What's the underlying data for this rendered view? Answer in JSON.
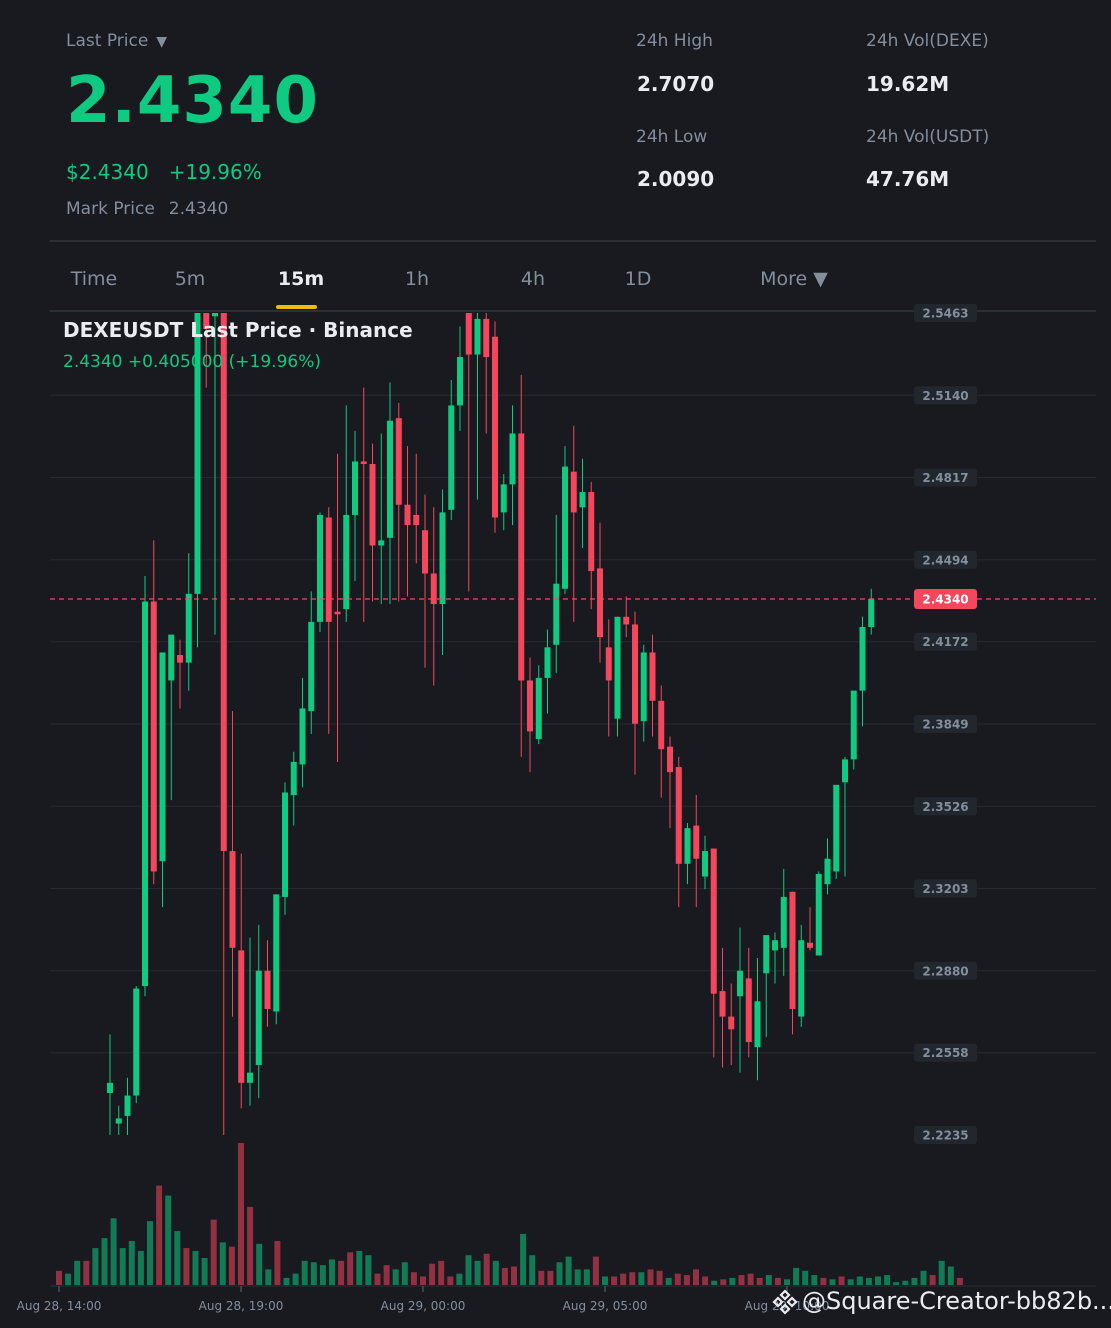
{
  "header": {
    "last_price_label": "Last Price",
    "caret": "▼",
    "last_price": "2.4340",
    "usd_price": "$2.4340",
    "change_pct": "+19.96%",
    "mark_price_label": "Mark Price",
    "mark_price": "2.4340",
    "stats": {
      "high_label": "24h High",
      "high": "2.7070",
      "low_label": "24h Low",
      "low": "2.0090",
      "vol_base_label": "24h Vol(DEXE)",
      "vol_base": "19.62M",
      "vol_quote_label": "24h Vol(USDT)",
      "vol_quote": "47.76M"
    }
  },
  "tabs": [
    {
      "label": "Time",
      "active": false
    },
    {
      "label": "5m",
      "active": false
    },
    {
      "label": "15m",
      "active": true
    },
    {
      "label": "1h",
      "active": false
    },
    {
      "label": "4h",
      "active": false
    },
    {
      "label": "1D",
      "active": false
    },
    {
      "label": "More ▼",
      "active": false
    }
  ],
  "legend": {
    "title": "DEXEUSDT Last Price · Binance",
    "values": "2.4340  +0.405000 (+19.96%)"
  },
  "watermark": "@Square-Creator-bb82b...",
  "colors": {
    "up": "#0ecb81",
    "down": "#f6465d",
    "accent": "#f0b90b",
    "background": "#181a20"
  },
  "chart_data": {
    "type": "candlestick",
    "symbol": "DEXEUSDT",
    "interval": "15m",
    "current_price": 2.434,
    "y_ticks": [
      "2.5463",
      "2.5140",
      "2.4817",
      "2.4494",
      "2.4172",
      "2.3849",
      "2.3526",
      "2.3203",
      "2.2880",
      "2.2558",
      "2.2235"
    ],
    "y_range": [
      2.2235,
      2.5463
    ],
    "x_ticks": [
      "Aug 28, 14:00",
      "Aug 28, 19:00",
      "Aug 29, 00:00",
      "Aug 29, 05:00",
      "Aug 29, 10:00"
    ],
    "candles": [
      {
        "o": 2.24,
        "h": 2.263,
        "l": 2.22,
        "c": 2.244
      },
      {
        "o": 2.228,
        "h": 2.235,
        "l": 2.22,
        "c": 2.23
      },
      {
        "o": 2.231,
        "h": 2.246,
        "l": 2.22,
        "c": 2.239
      },
      {
        "o": 2.239,
        "h": 2.282,
        "l": 2.236,
        "c": 2.281
      },
      {
        "o": 2.282,
        "h": 2.443,
        "l": 2.278,
        "c": 2.433
      },
      {
        "o": 2.433,
        "h": 2.457,
        "l": 2.322,
        "c": 2.327
      },
      {
        "o": 2.331,
        "h": 2.406,
        "l": 2.313,
        "c": 2.413
      },
      {
        "o": 2.402,
        "h": 2.419,
        "l": 2.355,
        "c": 2.42
      },
      {
        "o": 2.412,
        "h": 2.418,
        "l": 2.391,
        "c": 2.409
      },
      {
        "o": 2.409,
        "h": 2.452,
        "l": 2.398,
        "c": 2.436
      },
      {
        "o": 2.436,
        "h": 2.57,
        "l": 2.415,
        "c": 2.56
      },
      {
        "o": 2.56,
        "h": 2.61,
        "l": 2.517,
        "c": 2.54
      },
      {
        "o": 2.545,
        "h": 2.6,
        "l": 2.42,
        "c": 2.58
      },
      {
        "o": 2.59,
        "h": 2.62,
        "l": 2.21,
        "c": 2.335
      },
      {
        "o": 2.335,
        "h": 2.39,
        "l": 2.27,
        "c": 2.297
      },
      {
        "o": 2.296,
        "h": 2.334,
        "l": 2.234,
        "c": 2.244
      },
      {
        "o": 2.244,
        "h": 2.301,
        "l": 2.235,
        "c": 2.248
      },
      {
        "o": 2.251,
        "h": 2.306,
        "l": 2.238,
        "c": 2.288
      },
      {
        "o": 2.288,
        "h": 2.3,
        "l": 2.266,
        "c": 2.273
      },
      {
        "o": 2.272,
        "h": 2.314,
        "l": 2.267,
        "c": 2.318
      },
      {
        "o": 2.317,
        "h": 2.362,
        "l": 2.31,
        "c": 2.358
      },
      {
        "o": 2.357,
        "h": 2.374,
        "l": 2.345,
        "c": 2.37
      },
      {
        "o": 2.369,
        "h": 2.403,
        "l": 2.36,
        "c": 2.391
      },
      {
        "o": 2.39,
        "h": 2.437,
        "l": 2.381,
        "c": 2.425
      },
      {
        "o": 2.425,
        "h": 2.468,
        "l": 2.421,
        "c": 2.467
      },
      {
        "o": 2.466,
        "h": 2.47,
        "l": 2.381,
        "c": 2.425
      },
      {
        "o": 2.429,
        "h": 2.491,
        "l": 2.37,
        "c": 2.428
      },
      {
        "o": 2.43,
        "h": 2.51,
        "l": 2.425,
        "c": 2.467
      },
      {
        "o": 2.467,
        "h": 2.5,
        "l": 2.441,
        "c": 2.488
      },
      {
        "o": 2.488,
        "h": 2.517,
        "l": 2.425,
        "c": 2.487
      },
      {
        "o": 2.487,
        "h": 2.495,
        "l": 2.433,
        "c": 2.455
      },
      {
        "o": 2.455,
        "h": 2.499,
        "l": 2.432,
        "c": 2.457
      },
      {
        "o": 2.458,
        "h": 2.519,
        "l": 2.432,
        "c": 2.504
      },
      {
        "o": 2.505,
        "h": 2.511,
        "l": 2.433,
        "c": 2.471
      },
      {
        "o": 2.471,
        "h": 2.494,
        "l": 2.435,
        "c": 2.463
      },
      {
        "o": 2.467,
        "h": 2.491,
        "l": 2.448,
        "c": 2.463
      },
      {
        "o": 2.461,
        "h": 2.475,
        "l": 2.407,
        "c": 2.444
      },
      {
        "o": 2.444,
        "h": 2.47,
        "l": 2.4,
        "c": 2.432
      },
      {
        "o": 2.432,
        "h": 2.477,
        "l": 2.412,
        "c": 2.468
      },
      {
        "o": 2.469,
        "h": 2.52,
        "l": 2.465,
        "c": 2.51
      },
      {
        "o": 2.51,
        "h": 2.541,
        "l": 2.5,
        "c": 2.529
      },
      {
        "o": 2.566,
        "h": 2.58,
        "l": 2.437,
        "c": 2.53
      },
      {
        "o": 2.53,
        "h": 2.56,
        "l": 2.473,
        "c": 2.544
      },
      {
        "o": 2.544,
        "h": 2.55,
        "l": 2.499,
        "c": 2.529
      },
      {
        "o": 2.537,
        "h": 2.543,
        "l": 2.46,
        "c": 2.466
      },
      {
        "o": 2.468,
        "h": 2.483,
        "l": 2.461,
        "c": 2.479
      },
      {
        "o": 2.479,
        "h": 2.51,
        "l": 2.463,
        "c": 2.499
      },
      {
        "o": 2.499,
        "h": 2.522,
        "l": 2.372,
        "c": 2.402
      },
      {
        "o": 2.402,
        "h": 2.411,
        "l": 2.366,
        "c": 2.382
      },
      {
        "o": 2.379,
        "h": 2.408,
        "l": 2.377,
        "c": 2.403
      },
      {
        "o": 2.403,
        "h": 2.422,
        "l": 2.389,
        "c": 2.415
      },
      {
        "o": 2.416,
        "h": 2.467,
        "l": 2.405,
        "c": 2.44
      },
      {
        "o": 2.438,
        "h": 2.494,
        "l": 2.436,
        "c": 2.486
      },
      {
        "o": 2.484,
        "h": 2.502,
        "l": 2.425,
        "c": 2.468
      },
      {
        "o": 2.47,
        "h": 2.489,
        "l": 2.454,
        "c": 2.476
      },
      {
        "o": 2.476,
        "h": 2.48,
        "l": 2.43,
        "c": 2.445
      },
      {
        "o": 2.446,
        "h": 2.464,
        "l": 2.409,
        "c": 2.419
      },
      {
        "o": 2.415,
        "h": 2.426,
        "l": 2.38,
        "c": 2.402
      },
      {
        "o": 2.387,
        "h": 2.423,
        "l": 2.38,
        "c": 2.427
      },
      {
        "o": 2.427,
        "h": 2.435,
        "l": 2.419,
        "c": 2.424
      },
      {
        "o": 2.424,
        "h": 2.429,
        "l": 2.365,
        "c": 2.385
      },
      {
        "o": 2.386,
        "h": 2.416,
        "l": 2.378,
        "c": 2.413
      },
      {
        "o": 2.413,
        "h": 2.42,
        "l": 2.38,
        "c": 2.394
      },
      {
        "o": 2.394,
        "h": 2.4,
        "l": 2.356,
        "c": 2.375
      },
      {
        "o": 2.376,
        "h": 2.38,
        "l": 2.344,
        "c": 2.366
      },
      {
        "o": 2.368,
        "h": 2.372,
        "l": 2.313,
        "c": 2.33
      },
      {
        "o": 2.33,
        "h": 2.346,
        "l": 2.322,
        "c": 2.344
      },
      {
        "o": 2.345,
        "h": 2.357,
        "l": 2.313,
        "c": 2.332
      },
      {
        "o": 2.325,
        "h": 2.341,
        "l": 2.32,
        "c": 2.335
      },
      {
        "o": 2.336,
        "h": 2.335,
        "l": 2.254,
        "c": 2.279
      },
      {
        "o": 2.28,
        "h": 2.297,
        "l": 2.25,
        "c": 2.27
      },
      {
        "o": 2.27,
        "h": 2.283,
        "l": 2.251,
        "c": 2.265
      },
      {
        "o": 2.278,
        "h": 2.305,
        "l": 2.248,
        "c": 2.288
      },
      {
        "o": 2.285,
        "h": 2.297,
        "l": 2.254,
        "c": 2.26
      },
      {
        "o": 2.258,
        "h": 2.293,
        "l": 2.245,
        "c": 2.276
      },
      {
        "o": 2.287,
        "h": 2.296,
        "l": 2.262,
        "c": 2.302
      },
      {
        "o": 2.296,
        "h": 2.303,
        "l": 2.283,
        "c": 2.3
      },
      {
        "o": 2.297,
        "h": 2.328,
        "l": 2.286,
        "c": 2.317
      },
      {
        "o": 2.319,
        "h": 2.318,
        "l": 2.263,
        "c": 2.273
      },
      {
        "o": 2.27,
        "h": 2.306,
        "l": 2.266,
        "c": 2.3
      },
      {
        "o": 2.299,
        "h": 2.313,
        "l": 2.296,
        "c": 2.297
      },
      {
        "o": 2.294,
        "h": 2.327,
        "l": 2.295,
        "c": 2.326
      },
      {
        "o": 2.322,
        "h": 2.34,
        "l": 2.318,
        "c": 2.332
      },
      {
        "o": 2.327,
        "h": 2.359,
        "l": 2.324,
        "c": 2.361
      },
      {
        "o": 2.362,
        "h": 2.372,
        "l": 2.325,
        "c": 2.371
      },
      {
        "o": 2.371,
        "h": 2.396,
        "l": 2.367,
        "c": 2.398
      },
      {
        "o": 2.398,
        "h": 2.427,
        "l": 2.384,
        "c": 2.423
      },
      {
        "o": 2.423,
        "h": 2.438,
        "l": 2.42,
        "c": 2.434
      }
    ],
    "volume": [
      0.1,
      0.08,
      0.17,
      0.17,
      0.26,
      0.33,
      0.47,
      0.26,
      0.31,
      0.24,
      0.45,
      0.7,
      0.63,
      0.38,
      0.26,
      0.24,
      0.19,
      0.46,
      0.3,
      0.27,
      1.0,
      0.55,
      0.29,
      0.11,
      0.31,
      0.05,
      0.08,
      0.17,
      0.16,
      0.14,
      0.18,
      0.17,
      0.23,
      0.24,
      0.21,
      0.08,
      0.14,
      0.11,
      0.16,
      0.09,
      0.06,
      0.15,
      0.17,
      0.06,
      0.08,
      0.21,
      0.17,
      0.22,
      0.17,
      0.12,
      0.13,
      0.36,
      0.21,
      0.1,
      0.1,
      0.16,
      0.2,
      0.11,
      0.11,
      0.2,
      0.06,
      0.06,
      0.08,
      0.09,
      0.09,
      0.11,
      0.1,
      0.05,
      0.08,
      0.07,
      0.11,
      0.06,
      0.03,
      0.04,
      0.05,
      0.07,
      0.08,
      0.05,
      0.07,
      0.05,
      0.04,
      0.12,
      0.1,
      0.07,
      0.05,
      0.04,
      0.06,
      0.04,
      0.06,
      0.05,
      0.06,
      0.07,
      0.02,
      0.03,
      0.05,
      0.1,
      0.07,
      0.17,
      0.13,
      0.05
    ]
  }
}
